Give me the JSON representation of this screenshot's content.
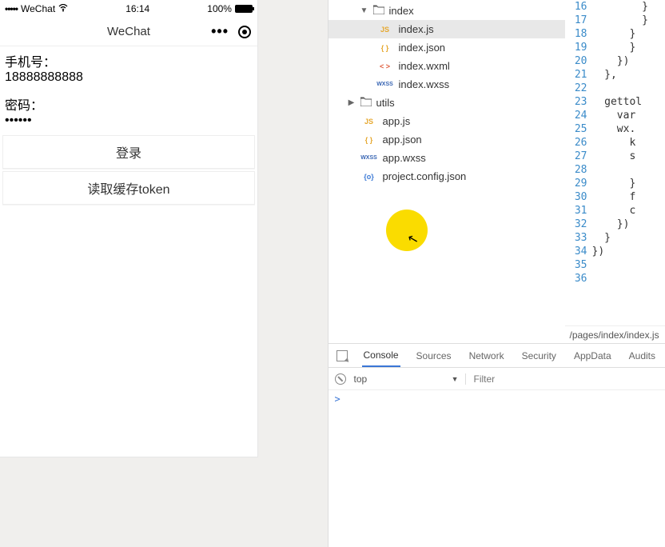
{
  "simulator": {
    "status": {
      "carrier_dots": "•••••",
      "carrier": "WeChat",
      "time": "16:14",
      "battery_pct": "100%"
    },
    "navbar": {
      "title": "WeChat"
    },
    "page": {
      "phone_label": "手机号：",
      "phone_value": "18888888888",
      "password_label": "密码：",
      "password_dots": "••••••",
      "login_btn": "登录",
      "read_token_btn": "读取缓存token"
    }
  },
  "file_tree": {
    "index_folder": "index",
    "files_index": [
      {
        "icon": "JS",
        "name": "index.js",
        "cls": "ic-js",
        "selected": true
      },
      {
        "icon": "{ }",
        "name": "index.json",
        "cls": "ic-json",
        "selected": false
      },
      {
        "icon": "< >",
        "name": "index.wxml",
        "cls": "ic-wxml",
        "selected": false
      },
      {
        "icon": "WXSS",
        "name": "index.wxss",
        "cls": "ic-wxss",
        "selected": false
      }
    ],
    "utils_folder": "utils",
    "root_files": [
      {
        "icon": "JS",
        "name": "app.js",
        "cls": "ic-js"
      },
      {
        "icon": "{ }",
        "name": "app.json",
        "cls": "ic-json"
      },
      {
        "icon": "WXSS",
        "name": "app.wxss",
        "cls": "ic-wxss"
      },
      {
        "icon": "{o}",
        "name": "project.config.json",
        "cls": "ic-cfg"
      }
    ]
  },
  "code": {
    "line_start": 16,
    "line_end": 36,
    "lines": [
      "        }",
      "        }",
      "      }",
      "      }",
      "    })",
      "  },",
      "",
      "  gettol",
      "    var",
      "    wx.",
      "      k",
      "      s",
      "",
      "      }",
      "      f",
      "      c",
      "    })",
      "  }",
      "})",
      ""
    ],
    "breadcrumb": "/pages/index/index.js"
  },
  "devtools": {
    "tabs": [
      "Console",
      "Sources",
      "Network",
      "Security",
      "AppData",
      "Audits"
    ],
    "active_tab": 0,
    "context": "top",
    "filter_placeholder": "Filter",
    "prompt": ">"
  }
}
